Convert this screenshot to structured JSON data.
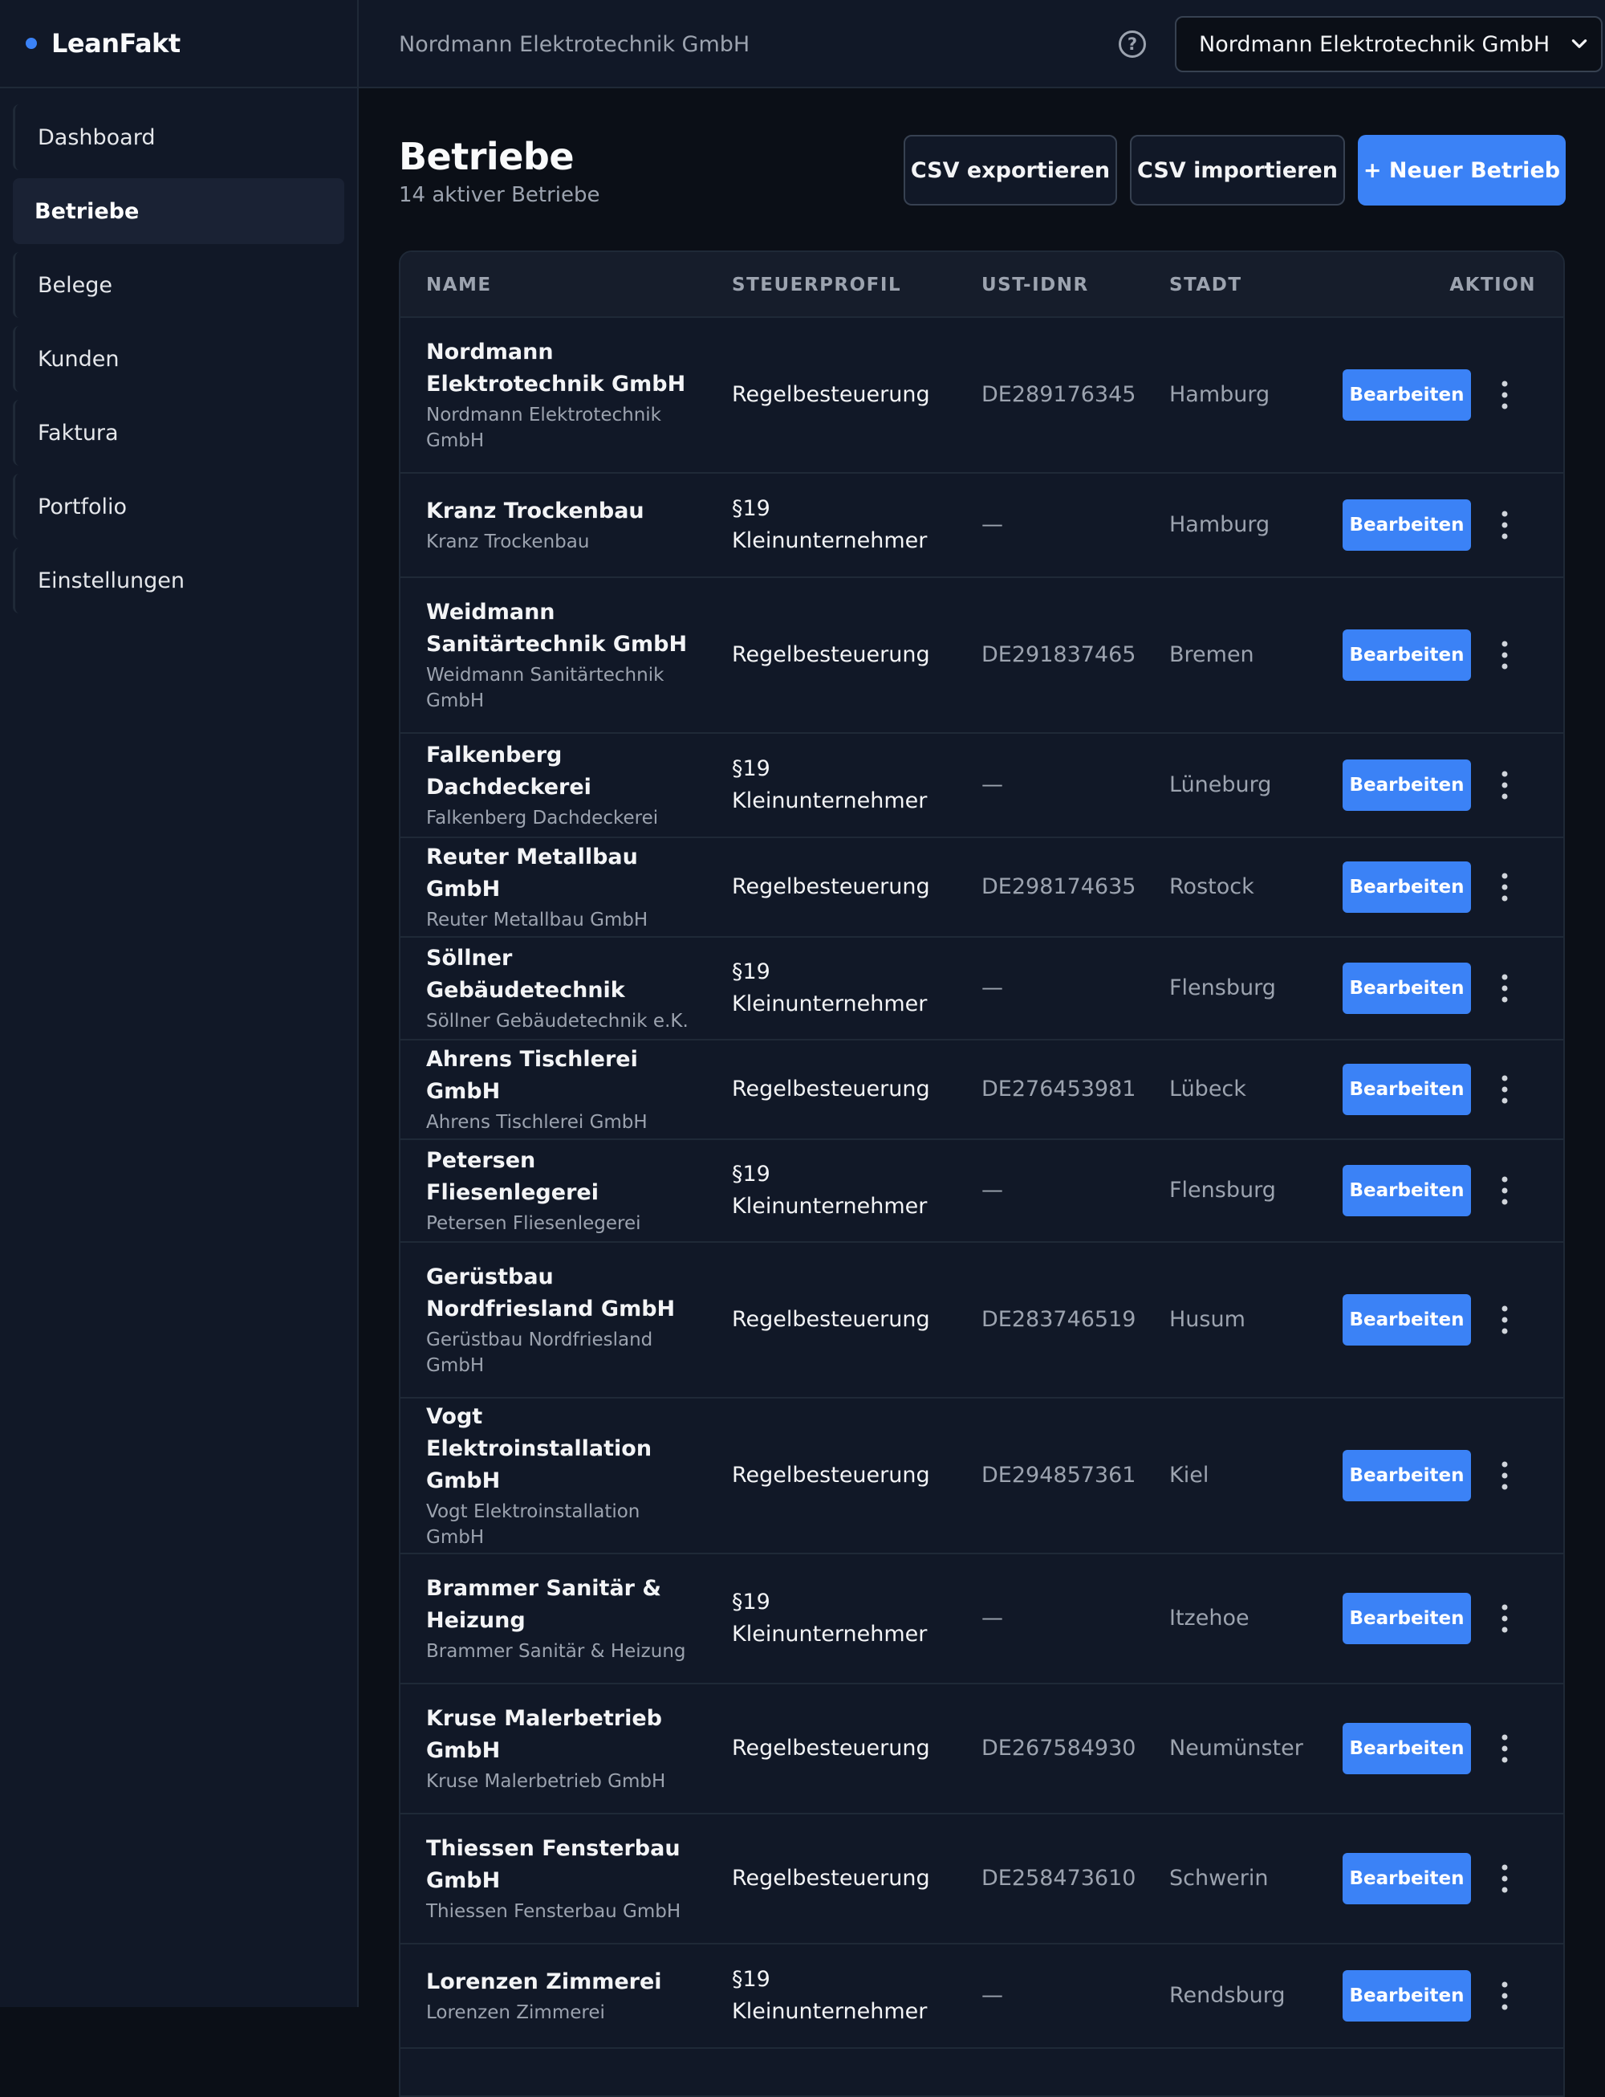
{
  "app": {
    "brand": "LeanFakt",
    "accent": "#3b82f6"
  },
  "sidebar": {
    "items": [
      {
        "label": "Dashboard",
        "active": false
      },
      {
        "label": "Betriebe",
        "active": true
      },
      {
        "label": "Belege",
        "active": false
      },
      {
        "label": "Kunden",
        "active": false
      },
      {
        "label": "Faktura",
        "active": false
      },
      {
        "label": "Portfolio",
        "active": false
      },
      {
        "label": "Einstellungen",
        "active": false
      }
    ]
  },
  "topbar": {
    "title": "Nordmann Elektrotechnik GmbH",
    "help_icon": "?",
    "org_selected": "Nordmann Elektrotechnik GmbH"
  },
  "page": {
    "title": "Betriebe",
    "subtitle": "14 aktiver Betriebe",
    "export_label": "CSV exportieren",
    "import_label": "CSV importieren",
    "new_label": "+ Neuer Betrieb"
  },
  "table": {
    "headers": {
      "name": "NAME",
      "tax": "STEUERPROFIL",
      "vat": "UST-IDNR",
      "city": "STADT",
      "action": "AKTION"
    },
    "edit_label": "Bearbeiten",
    "rows": [
      {
        "name": "Nordmann Elektrotechnik GmbH",
        "sub": "Nordmann Elektrotechnik GmbH",
        "tax": "Regelbesteuerung",
        "vat": "DE289176345",
        "city": "Hamburg"
      },
      {
        "name": "Kranz Trockenbau",
        "sub": "Kranz Trockenbau",
        "tax": "§19 Kleinunternehmer",
        "vat": "—",
        "city": "Hamburg"
      },
      {
        "name": "Weidmann Sanitärtechnik GmbH",
        "sub": "Weidmann Sanitärtechnik GmbH",
        "tax": "Regelbesteuerung",
        "vat": "DE291837465",
        "city": "Bremen"
      },
      {
        "name": "Falkenberg Dachdeckerei",
        "sub": "Falkenberg Dachdeckerei",
        "tax": "§19 Kleinunternehmer",
        "vat": "—",
        "city": "Lüneburg"
      },
      {
        "name": "Reuter Metallbau GmbH",
        "sub": "Reuter Metallbau GmbH",
        "tax": "Regelbesteuerung",
        "vat": "DE298174635",
        "city": "Rostock"
      },
      {
        "name": "Söllner Gebäudetechnik",
        "sub": "Söllner Gebäudetechnik e.K.",
        "tax": "§19 Kleinunternehmer",
        "vat": "—",
        "city": "Flensburg"
      },
      {
        "name": "Ahrens Tischlerei GmbH",
        "sub": "Ahrens Tischlerei GmbH",
        "tax": "Regelbesteuerung",
        "vat": "DE276453981",
        "city": "Lübeck"
      },
      {
        "name": "Petersen Fliesenlegerei",
        "sub": "Petersen Fliesenlegerei",
        "tax": "§19 Kleinunternehmer",
        "vat": "—",
        "city": "Flensburg"
      },
      {
        "name": "Gerüstbau Nordfriesland GmbH",
        "sub": "Gerüstbau Nordfriesland GmbH",
        "tax": "Regelbesteuerung",
        "vat": "DE283746519",
        "city": "Husum"
      },
      {
        "name": "Vogt Elektroinstallation GmbH",
        "sub": "Vogt Elektroinstallation GmbH",
        "tax": "Regelbesteuerung",
        "vat": "DE294857361",
        "city": "Kiel"
      },
      {
        "name": "Brammer Sanitär & Heizung",
        "sub": "Brammer Sanitär & Heizung",
        "tax": "§19 Kleinunternehmer",
        "vat": "—",
        "city": "Itzehoe"
      },
      {
        "name": "Kruse Malerbetrieb GmbH",
        "sub": "Kruse Malerbetrieb GmbH",
        "tax": "Regelbesteuerung",
        "vat": "DE267584930",
        "city": "Neumünster"
      },
      {
        "name": "Thiessen Fensterbau GmbH",
        "sub": "Thiessen Fensterbau GmbH",
        "tax": "Regelbesteuerung",
        "vat": "DE258473610",
        "city": "Schwerin"
      },
      {
        "name": "Lorenzen Zimmerei",
        "sub": "Lorenzen Zimmerei",
        "tax": "§19 Kleinunternehmer",
        "vat": "—",
        "city": "Rendsburg"
      }
    ]
  }
}
